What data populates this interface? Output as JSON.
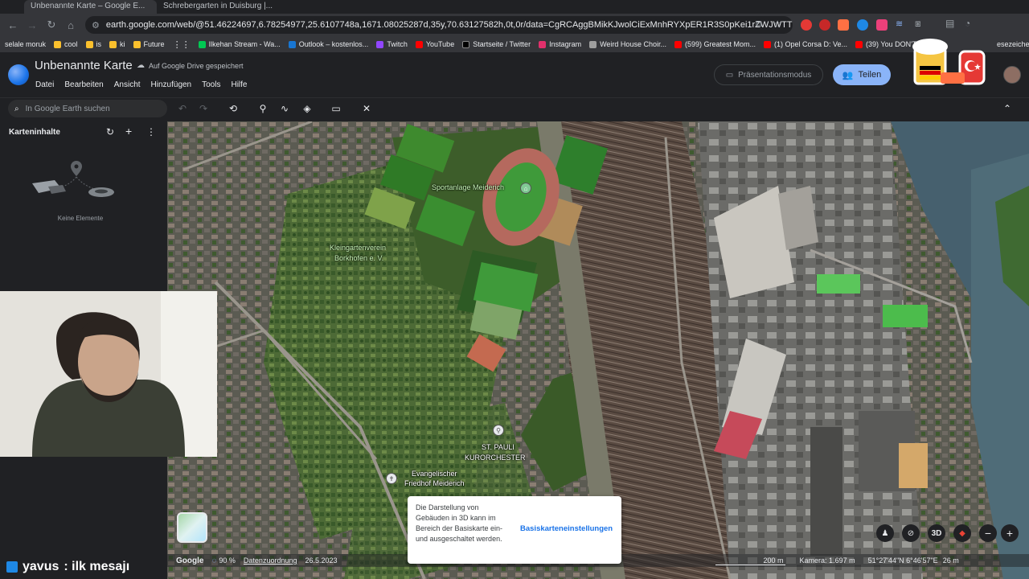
{
  "browser": {
    "tabs": [
      {
        "label": "Unbenannte Karte – Google E..."
      },
      {
        "label": "Schrebergarten in Duisburg |..."
      }
    ],
    "url": "earth.google.com/web/@51.46224697,6.78254977,25.6107748a,1671.08025287d,35y,70.63127582h,0t,0r/data=CgRCAggBMikKJwolCiExMnhRYXpER1R3S0pKei1rZWJWTTFDdFFVLWRySUpGY3Qg...",
    "bookmarks": [
      "selale moruk",
      "cool",
      "is",
      "ki",
      "Future",
      "Ilkehan Stream - Wa...",
      "Outlook – kostenlos...",
      "Twitch",
      "YouTube",
      "Startseite / Twitter",
      "Instagram",
      "Weird House Choir...",
      "(599) Greatest Mom...",
      "(1) Opel Corsa D: Ve...",
      "(39) You DON'T Eve...",
      "esezeichen"
    ]
  },
  "app": {
    "title": "Unbenannte Karte",
    "save_status": "Auf Google Drive gespeichert",
    "menu": [
      "Datei",
      "Bearbeiten",
      "Ansicht",
      "Hinzufügen",
      "Tools",
      "Hilfe"
    ],
    "present_label": "Präsentationsmodus",
    "share_label": "Teilen"
  },
  "search": {
    "placeholder": "In Google Earth suchen"
  },
  "panel": {
    "title": "Karteninhalte",
    "empty_text": "Keine Elemente"
  },
  "chat": {
    "user": "yavus",
    "message": ": ilk mesajı"
  },
  "map": {
    "labels": {
      "sport": "Sportanlage Meiderich",
      "garden_1": "Kleingartenverein",
      "garden_2": "Borkhofen e. V.",
      "stpauli_1": "ST. PAULI",
      "stpauli_2": "KURORCHESTER",
      "cemetery_1": "Evangelischer",
      "cemetery_2": "Friedhof Meiderich"
    },
    "footer": {
      "brand": "Google",
      "load_percent": "90 %",
      "attribution": "Datenzuordnung",
      "date": "26.5.2023",
      "scale": "200 m",
      "camera": "Kamera: 1.697 m",
      "coords": "51°27'44\"N 6°46'57\"E",
      "elevation": "26 m"
    },
    "tooltip": {
      "text": "Die Darstellung von Gebäuden in 3D kann im Bereich der Basiskarte ein- und ausgeschaltet werden.",
      "link": "Basiskarteneinstellungen"
    },
    "controls": {
      "three_d": "3D"
    }
  },
  "colors": {
    "accent": "#8ab4f8",
    "link": "#1a73e8",
    "background": "#202124"
  }
}
